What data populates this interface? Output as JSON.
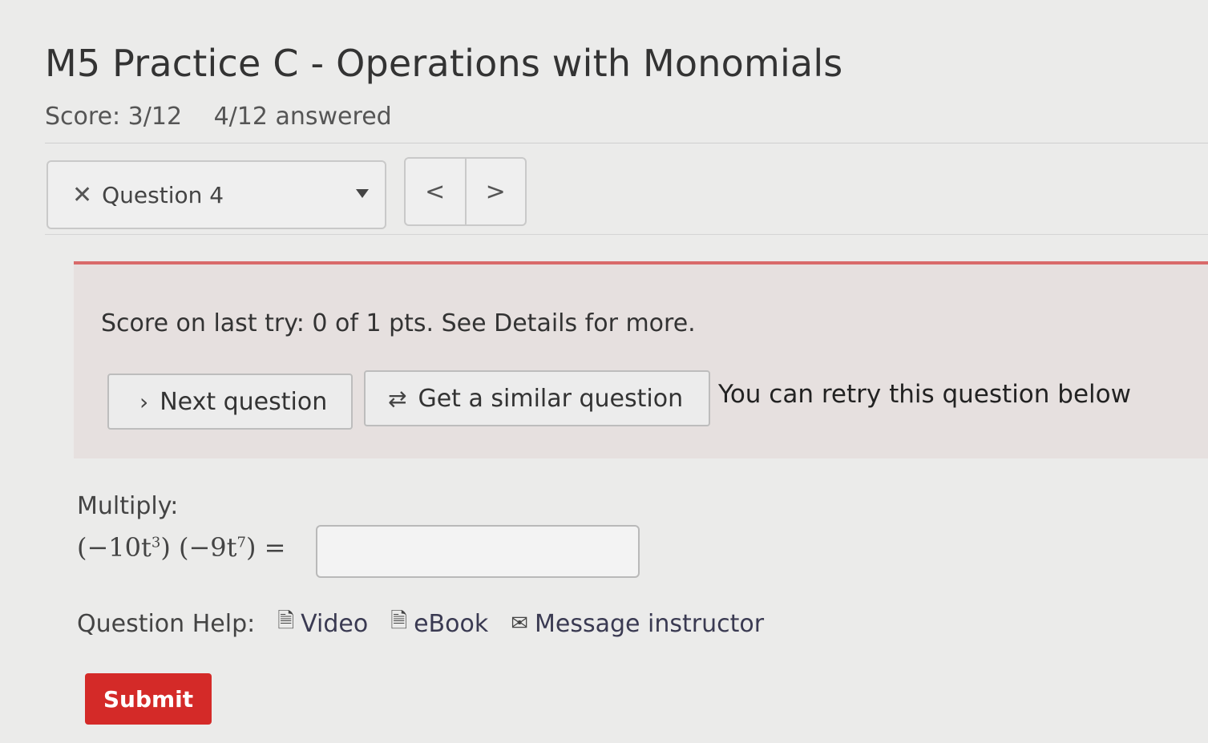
{
  "header": {
    "title": "M5 Practice C - Operations with Monomials",
    "score": "Score: 3/12",
    "answered": "4/12 answered"
  },
  "question_nav": {
    "status_icon": "close-icon",
    "selected": "Question 4",
    "prev_label": "<",
    "next_label": ">"
  },
  "alert": {
    "message": "Score on last try: 0 of 1 pts. See Details for more.",
    "next_question_label": "Next question",
    "similar_question_label": "Get a similar question",
    "retry_note": "You can retry this question below"
  },
  "question": {
    "prompt": "Multiply:",
    "expression": {
      "factor1_coef": "(−10t",
      "factor1_exp": "3",
      "factor2_coef": "(−9t",
      "factor2_exp": "7",
      "equals": "="
    },
    "answer_value": ""
  },
  "help": {
    "label": "Question Help:",
    "video": "Video",
    "ebook": "eBook",
    "message": "Message instructor"
  },
  "submit_label": "Submit",
  "colors": {
    "submit": "#d42a28",
    "alert_border": "#d96a6a"
  }
}
